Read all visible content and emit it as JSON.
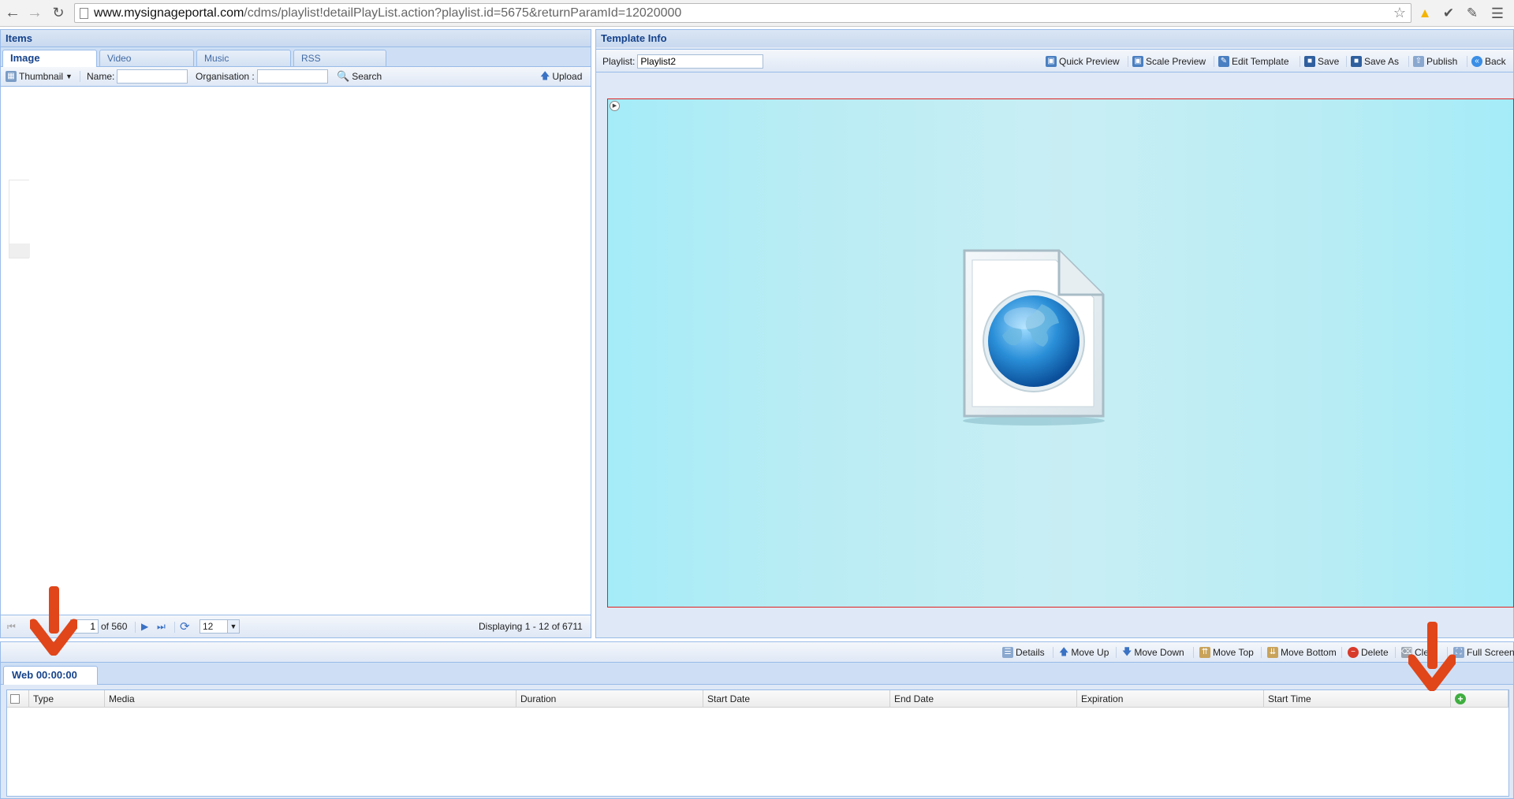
{
  "browser": {
    "url_host": "www.mysignageportal.com",
    "url_path": "/cdms/playlist!detailPlayList.action?playlist.id=5675&returnParamId=12020000"
  },
  "items_panel": {
    "title": "Items",
    "tabs": [
      "Image",
      "Video",
      "Music",
      "RSS"
    ],
    "toolbar": {
      "view_label": "Thumbnail",
      "name_label": "Name:",
      "name_value": "",
      "org_label": "Organisation :",
      "org_value": "",
      "search_label": "Search",
      "upload_label": "Upload"
    },
    "pager": {
      "page_value": "1",
      "of_label": "of 560",
      "page_size": "12",
      "displaying": "Displaying 1 - 12 of 6711"
    }
  },
  "template_panel": {
    "title": "Template Info",
    "playlist_label": "Playlist:",
    "playlist_value": "Playlist2",
    "actions": [
      "Quick Preview",
      "Scale Preview",
      "Edit Template",
      "Save",
      "Save As",
      "Publish",
      "Back"
    ]
  },
  "bottom_toolbar": {
    "actions": [
      "Details",
      "Move Up",
      "Move Down",
      "Move Top",
      "Move Bottom",
      "Delete",
      "Clear",
      "Full Screen"
    ]
  },
  "zone_tab": {
    "label": "Web 00:00:00"
  },
  "grid": {
    "columns": [
      "Type",
      "Media",
      "Duration",
      "Start Date",
      "End Date",
      "Expiration",
      "Start Time"
    ]
  },
  "colors": {
    "panel_border": "#99bbe8",
    "header_text": "#15428b",
    "preview_bg": "#a8ecf6",
    "annotation_arrow": "#e0461a"
  }
}
